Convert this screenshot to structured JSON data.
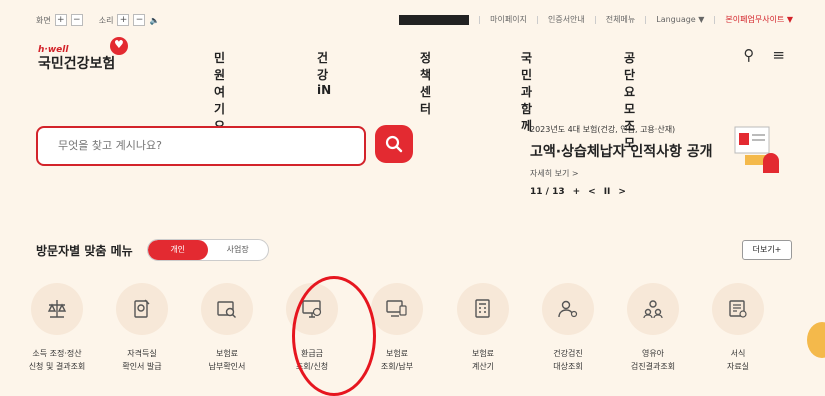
{
  "util": {
    "screen_label": "화면",
    "sound_label": "소리",
    "links": [
      "마이페이지",
      "인증서안내",
      "전체메뉴",
      "Language ▼",
      "본이페업무사이트 ▼"
    ]
  },
  "logo": {
    "small": "h·well",
    "big": "국민건강보험"
  },
  "nav": [
    "민원여기요",
    "건강iN",
    "정책센터",
    "국민과함께",
    "공단요모조모"
  ],
  "search": {
    "placeholder": "무엇을 찾고 계시나요?"
  },
  "notice": {
    "category": "2023년도 4대 보험(건강, 연금, 고용·산재)",
    "title": "고액·상습체납자 인적사항 공개",
    "more": "자세히 보기 >",
    "pager": "11 / 13",
    "plus": "+",
    "prev": "<",
    "pause": "II",
    "next": ">"
  },
  "visitor": {
    "label": "방문자별 맞춤 메뉴",
    "tabs": [
      "개인",
      "사업장"
    ],
    "more": "더보기+"
  },
  "menu": [
    {
      "line1": "소득 조정·정산",
      "line2": "신청 및 결과조회",
      "icon": "scale-icon"
    },
    {
      "line1": "자격득실",
      "line2": "확인서 발급",
      "icon": "certificate-icon"
    },
    {
      "line1": "보험료",
      "line2": "납부확인서",
      "icon": "receipt-search-icon"
    },
    {
      "line1": "환급금",
      "line2": "조회/신청",
      "icon": "refund-monitor-icon"
    },
    {
      "line1": "보험료",
      "line2": "조회/납부",
      "icon": "payment-monitor-icon"
    },
    {
      "line1": "보험료",
      "line2": "계산기",
      "icon": "calculator-icon"
    },
    {
      "line1": "건강검진",
      "line2": "대상조회",
      "icon": "health-check-icon"
    },
    {
      "line1": "영유아",
      "line2": "검진결과조회",
      "icon": "infant-icon"
    },
    {
      "line1": "서식",
      "line2": "자료실",
      "icon": "forms-icon"
    }
  ],
  "colors": {
    "accent": "#e32a31",
    "background": "#fdf5ea",
    "icon_bg": "#f7e8d8"
  }
}
